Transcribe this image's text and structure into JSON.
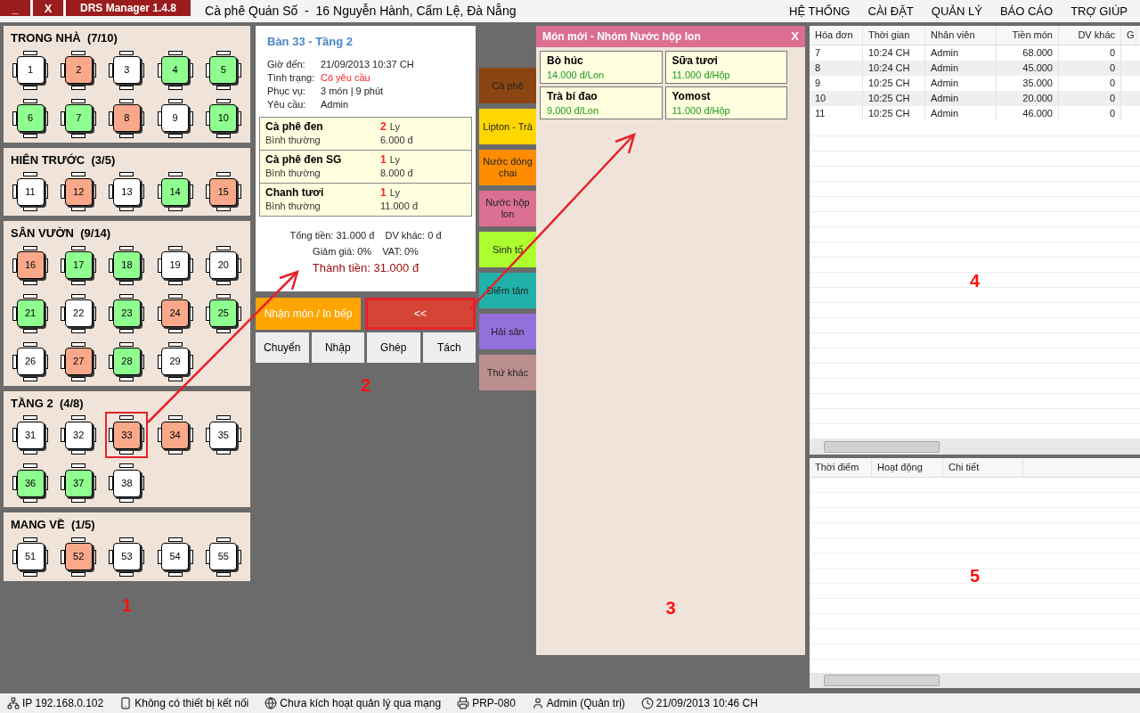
{
  "titlebar": {
    "buttons": [
      "_",
      "X"
    ],
    "app_name": "DRS Manager 1.4.8",
    "shop": "Cà phê Quán Số  -  16 Nguyễn Hành, Cẩm Lệ, Đà Nẵng",
    "menu": [
      "HỆ THỐNG",
      "CÀI ĐẶT",
      "QUẢN LÝ",
      "BÁO CÁO",
      "TRỢ GIÚP"
    ]
  },
  "areas": [
    {
      "title": "TRONG NHÀ  (7/10)",
      "tables": [
        {
          "label": "1",
          "color": "#ffffff",
          "highlighted": false
        },
        {
          "label": "2",
          "color": "#f9a88a",
          "highlighted": false
        },
        {
          "label": "3",
          "color": "#ffffff",
          "highlighted": false
        },
        {
          "label": "4",
          "color": "#8fff8f",
          "highlighted": false
        },
        {
          "label": "5",
          "color": "#8fff8f",
          "highlighted": false
        },
        {
          "label": "6",
          "color": "#8fff8f",
          "highlighted": false
        },
        {
          "label": "7",
          "color": "#8fff8f",
          "highlighted": false
        },
        {
          "label": "8",
          "color": "#f9a88a",
          "highlighted": false
        },
        {
          "label": "9",
          "color": "#ffffff",
          "highlighted": false
        },
        {
          "label": "10",
          "color": "#8fff8f",
          "highlighted": false
        }
      ]
    },
    {
      "title": "HIÊN TRƯỚC  (3/5)",
      "tables": [
        {
          "label": "11",
          "color": "#ffffff",
          "highlighted": false
        },
        {
          "label": "12",
          "color": "#f9a88a",
          "highlighted": false
        },
        {
          "label": "13",
          "color": "#ffffff",
          "highlighted": false
        },
        {
          "label": "14",
          "color": "#8fff8f",
          "highlighted": false
        },
        {
          "label": "15",
          "color": "#f9a88a",
          "highlighted": false
        }
      ]
    },
    {
      "title": "SÂN VƯỜN  (9/14)",
      "tables": [
        {
          "label": "16",
          "color": "#f9a88a",
          "highlighted": false
        },
        {
          "label": "17",
          "color": "#8fff8f",
          "highlighted": false
        },
        {
          "label": "18",
          "color": "#8fff8f",
          "highlighted": false
        },
        {
          "label": "19",
          "color": "#ffffff",
          "highlighted": false
        },
        {
          "label": "20",
          "color": "#ffffff",
          "highlighted": false
        },
        {
          "label": "21",
          "color": "#8fff8f",
          "highlighted": false
        },
        {
          "label": "22",
          "color": "#ffffff",
          "highlighted": false
        },
        {
          "label": "23",
          "color": "#8fff8f",
          "highlighted": false
        },
        {
          "label": "24",
          "color": "#f9a88a",
          "highlighted": false
        },
        {
          "label": "25",
          "color": "#8fff8f",
          "highlighted": false
        },
        {
          "label": "26",
          "color": "#ffffff",
          "highlighted": false
        },
        {
          "label": "27",
          "color": "#f9a88a",
          "highlighted": false
        },
        {
          "label": "28",
          "color": "#8fff8f",
          "highlighted": false
        },
        {
          "label": "29",
          "color": "#ffffff",
          "highlighted": false
        }
      ]
    },
    {
      "title": "TẦNG 2  (4/8)",
      "tables": [
        {
          "label": "31",
          "color": "#ffffff",
          "highlighted": false
        },
        {
          "label": "32",
          "color": "#ffffff",
          "highlighted": false
        },
        {
          "label": "33",
          "color": "#f9a88a",
          "highlighted": true
        },
        {
          "label": "34",
          "color": "#f9a88a",
          "highlighted": false
        },
        {
          "label": "35",
          "color": "#ffffff",
          "highlighted": false
        },
        {
          "label": "36",
          "color": "#8fff8f",
          "highlighted": false
        },
        {
          "label": "37",
          "color": "#8fff8f",
          "highlighted": false
        },
        {
          "label": "38",
          "color": "#ffffff",
          "highlighted": false
        }
      ]
    },
    {
      "title": "MANG VỀ  (1/5)",
      "tables": [
        {
          "label": "51",
          "color": "#ffffff",
          "highlighted": false
        },
        {
          "label": "52",
          "color": "#f9a88a",
          "highlighted": false
        },
        {
          "label": "53",
          "color": "#ffffff",
          "highlighted": false
        },
        {
          "label": "54",
          "color": "#ffffff",
          "highlighted": false
        },
        {
          "label": "55",
          "color": "#ffffff",
          "highlighted": false
        }
      ]
    }
  ],
  "order": {
    "title": "Bàn 33 - Tầng 2",
    "info": [
      {
        "label": "Giờ đến:",
        "value": "21/09/2013 10:37 CH",
        "alert": false
      },
      {
        "label": "Tình trạng:",
        "value": "Có yêu cầu",
        "alert": true
      },
      {
        "label": "Phục vụ:",
        "value": "3 món  |  9 phút",
        "alert": false
      },
      {
        "label": "Yêu cầu:",
        "value": "Admin",
        "alert": false
      }
    ],
    "items": [
      {
        "name": "Cà phê đen",
        "qty": "2",
        "unit": "Ly",
        "note": "Bình thường",
        "price": "6.000 đ"
      },
      {
        "name": "Cà phê đen SG",
        "qty": "1",
        "unit": "Ly",
        "note": "Bình thường",
        "price": "8.000 đ"
      },
      {
        "name": "Chanh tươi",
        "qty": "1",
        "unit": "Ly",
        "note": "Bình thường",
        "price": "11.000 đ"
      }
    ],
    "summary": [
      "Tổng tiền: 31.000 đ    DV khác: 0 đ",
      "Giảm giá: 0%    VAT: 0%"
    ],
    "total": "Thành tiền: 31.000 đ",
    "primary_buttons": [
      {
        "label": "Nhận món / In bếp",
        "kind": "confirm",
        "highlighted": false
      },
      {
        "label": "<<",
        "kind": "back",
        "highlighted": true
      }
    ],
    "actions": [
      "Chuyển",
      "Nhập",
      "Ghép",
      "Tách"
    ]
  },
  "categories": [
    {
      "label": "Cà phê",
      "color": "#8b4513"
    },
    {
      "label": "Lipton - Trà",
      "color": "#ffd700"
    },
    {
      "label": "Nước đóng chai",
      "color": "#ff8c00"
    },
    {
      "label": "Nước hộp lon",
      "color": "#db7093"
    },
    {
      "label": "Sinh tố",
      "color": "#adff2f"
    },
    {
      "label": "Điểm tâm",
      "color": "#20b2aa"
    },
    {
      "label": "Hải sản",
      "color": "#9370db"
    },
    {
      "label": "Thứ khác",
      "color": "#bc8f8f"
    }
  ],
  "menu_dialog": {
    "title": "Món mới - Nhóm Nước hộp lon",
    "close": "X",
    "items": [
      {
        "name": "Bò húc",
        "price": "14.000 đ/Lon"
      },
      {
        "name": "Sữa tươi",
        "price": "11.000 đ/Hộp"
      },
      {
        "name": "Trà bí đao",
        "price": "9.000 đ/Lon"
      },
      {
        "name": "Yomost",
        "price": "11.000 đ/Hộp"
      }
    ]
  },
  "invoices": {
    "columns": [
      "Hóa đơn",
      "Thời gian",
      "Nhân viên",
      "Tiền món",
      "DV khác",
      "G"
    ],
    "rows": [
      [
        "7",
        "10:24 CH",
        "Admin",
        "68.000",
        "0"
      ],
      [
        "8",
        "10:24 CH",
        "Admin",
        "45.000",
        "0"
      ],
      [
        "9",
        "10:25 CH",
        "Admin",
        "35.000",
        "0"
      ],
      [
        "10",
        "10:25 CH",
        "Admin",
        "20.000",
        "0"
      ],
      [
        "11",
        "10:25 CH",
        "Admin",
        "46.000",
        "0"
      ]
    ]
  },
  "activity_log": {
    "columns": [
      "Thời điểm",
      "Hoạt động",
      "Chi tiết"
    ]
  },
  "annotations": [
    "1",
    "2",
    "3",
    "4",
    "5"
  ],
  "status_bar": [
    {
      "kind": "network",
      "text": "IP 192.168.0.102"
    },
    {
      "kind": "device",
      "text": "Không có thiết bị kết nối"
    },
    {
      "kind": "globe",
      "text": "Chưa kích hoạt quản lý qua mạng"
    },
    {
      "kind": "printer",
      "text": "PRP-080"
    },
    {
      "kind": "user",
      "text": "Admin (Quản trị)"
    },
    {
      "kind": "clock",
      "text": "21/09/2013 10:46 CH"
    }
  ]
}
